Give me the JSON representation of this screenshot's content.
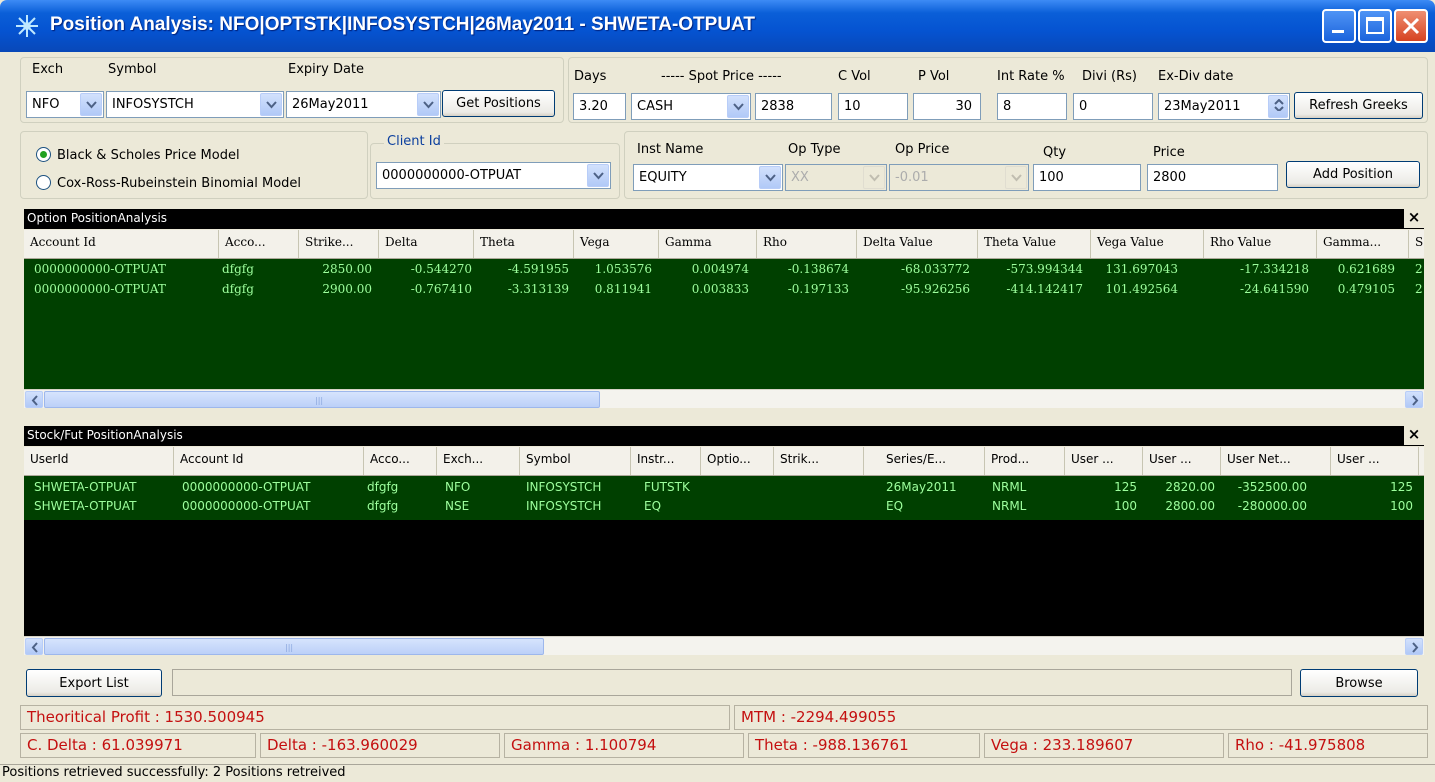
{
  "window": {
    "title": "Position Analysis: NFO|OPTSTK|INFOSYSTCH|26May2011 - SHWETA-OTPUAT"
  },
  "selector": {
    "exch_label": "Exch",
    "exch_value": "NFO",
    "symbol_label": "Symbol",
    "symbol_value": "INFOSYSTCH",
    "expiry_label": "Expiry Date",
    "expiry_value": "26May2011",
    "get_positions": "Get Positions"
  },
  "greeks": {
    "days_label": "Days",
    "days_value": "3.20",
    "spot_label": "----- Spot Price -----",
    "spot_type": "CASH",
    "spot_value": "2838",
    "cvol_label": "C Vol",
    "cvol_value": "10",
    "pvol_label": "P Vol",
    "pvol_value": "30",
    "rate_label": "Int Rate %",
    "rate_value": "8",
    "divi_label": "Divi (Rs)",
    "divi_value": "0",
    "exdiv_label": "Ex-Div date",
    "exdiv_value": "23May2011",
    "refresh": "Refresh Greeks"
  },
  "model": {
    "black_scholes": "Black & Scholes Price Model",
    "crr": "Cox-Ross-Rubeinstein Binomial Model",
    "selected": "black_scholes"
  },
  "client": {
    "label": "Client Id",
    "value": "0000000000-OTPUAT"
  },
  "add": {
    "inst_label": "Inst Name",
    "inst_value": "EQUITY",
    "optype_label": "Op Type",
    "optype_value": "XX",
    "opprice_label": "Op Price",
    "opprice_value": "-0.01",
    "qty_label": "Qty",
    "qty_value": "100",
    "price_label": "Price",
    "price_value": "2800",
    "add_button": "Add Position"
  },
  "option_grid": {
    "title": "Option PositionAnalysis",
    "close": "×",
    "columns": [
      "Account Id",
      "Acco...",
      "Strike...",
      "Delta",
      "Theta",
      "Vega",
      "Gamma",
      "Rho",
      "Delta Value",
      "Theta Value",
      "Vega Value",
      "Rho Value",
      "Gamma...",
      "S"
    ],
    "rows": [
      [
        "0000000000-OTPUAT",
        "dfgfg",
        "2850.00",
        "-0.544270",
        "-4.591955",
        "1.053576",
        "0.004974",
        "-0.138674",
        "-68.033772",
        "-573.994344",
        "131.697043",
        "-17.334218",
        "0.621689",
        "2"
      ],
      [
        "0000000000-OTPUAT",
        "dfgfg",
        "2900.00",
        "-0.767410",
        "-3.313139",
        "0.811941",
        "0.003833",
        "-0.197133",
        "-95.926256",
        "-414.142417",
        "101.492564",
        "-24.641590",
        "0.479105",
        "2"
      ]
    ]
  },
  "stock_grid": {
    "title": "Stock/Fut PositionAnalysis",
    "close": "×",
    "columns": [
      "UserId",
      "Account Id",
      "Acco...",
      "Exch...",
      "Symbol",
      "Instr...",
      "Optio...",
      "Strik...",
      "Series/E...",
      "Prod...",
      "User ...",
      "User ...",
      "User Net...",
      "User ..."
    ],
    "rows": [
      [
        "SHWETA-OTPUAT",
        "0000000000-OTPUAT",
        "dfgfg",
        "NFO",
        "INFOSYSTCH",
        "FUTSTK",
        "",
        "",
        "26May2011",
        "NRML",
        "125",
        "2820.00",
        "-352500.00",
        "125"
      ],
      [
        "SHWETA-OTPUAT",
        "0000000000-OTPUAT",
        "dfgfg",
        "NSE",
        "INFOSYSTCH",
        "EQ",
        "",
        "",
        "EQ",
        "NRML",
        "100",
        "2800.00",
        "-280000.00",
        "100"
      ]
    ]
  },
  "bottom": {
    "export": "Export List",
    "browse": "Browse"
  },
  "summary": {
    "theoretical_profit": "Theoritical Profit : 1530.500945",
    "mtm": "MTM : -2294.499055",
    "c_delta": "C. Delta : 61.039971",
    "delta": "Delta : -163.960029",
    "gamma": "Gamma : 1.100794",
    "theta": "Theta : -988.136761",
    "vega": "Vega : 233.189607",
    "rho": "Rho : -41.975808"
  },
  "status": "Positions retrieved successfully: 2 Positions retreived",
  "colors": {
    "title_bar": "#0553d1",
    "grid_green": "#004000",
    "grid_text": "#9dff9d",
    "summary_text": "#c41010"
  },
  "icons": {
    "app": "app-network-icon"
  }
}
